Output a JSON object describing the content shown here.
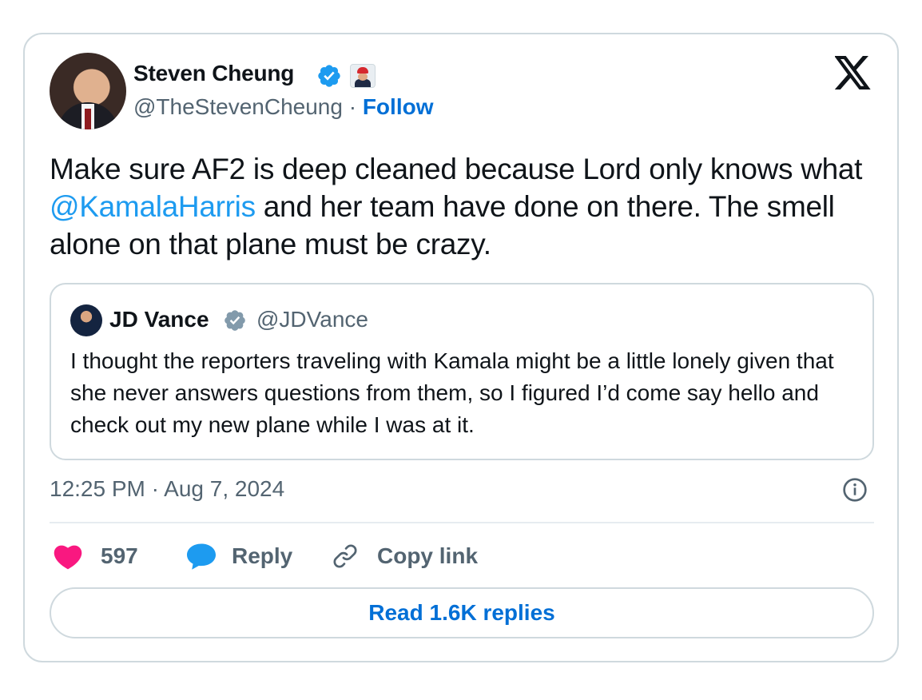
{
  "author": {
    "name": "Steven Cheung",
    "handle": "@TheStevenCheung",
    "separator": " · ",
    "follow_label": "Follow"
  },
  "tweet": {
    "text_before_mention": "Make sure AF2 is deep cleaned because Lord only knows what ",
    "mention": "@KamalaHarris",
    "text_after_mention": " and her team have done on there. The smell alone on that plane must be crazy."
  },
  "quote": {
    "name": "JD Vance",
    "handle": "@JDVance",
    "text": "I thought the reporters traveling with Kamala might be a little lonely given that she never answers questions from them, so I figured I’d come say hello and check out my new plane while I was at it."
  },
  "timestamp": "12:25 PM · Aug 7, 2024",
  "actions": {
    "likes": "597",
    "reply_label": "Reply",
    "copy_link_label": "Copy link"
  },
  "read_replies_label": "Read 1.6K replies",
  "colors": {
    "link_blue": "#006fd6",
    "mention_blue": "#1d9bf0",
    "heart_pink": "#f91880",
    "secondary_text": "#536471",
    "border": "#cfd9de"
  },
  "icons": {
    "verified": "verified-badge-icon",
    "brand": "x-logo-icon",
    "info": "info-icon",
    "like": "heart-icon",
    "reply": "speech-bubble-icon",
    "copy": "link-icon"
  }
}
